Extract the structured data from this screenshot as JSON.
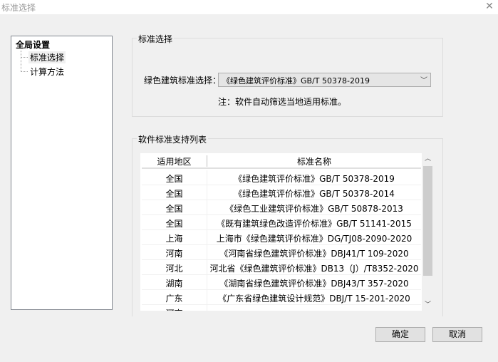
{
  "window": {
    "title": "标准选择",
    "close_icon": "close-icon"
  },
  "tree": {
    "root": "全局设置",
    "items": [
      {
        "label": "标准选择"
      },
      {
        "label": "计算方法"
      }
    ]
  },
  "standard_group": {
    "legend": "标准选择",
    "label": "绿色建筑标准选择：",
    "selected": "《绿色建筑评价标准》GB/T 50378-2019",
    "note": "注：软件自动筛选当地适用标准。"
  },
  "list_group": {
    "legend": "软件标准支持列表",
    "headers": [
      "适用地区",
      "标准名称"
    ],
    "rows": [
      [
        "全国",
        "《绿色建筑评价标准》GB/T 50378-2019"
      ],
      [
        "全国",
        "《绿色建筑评价标准》GB/T 50378-2014"
      ],
      [
        "全国",
        "《绿色工业建筑评价标准》GB/T 50878-2013"
      ],
      [
        "全国",
        "《既有建筑绿色改造评价标准》GB/T 51141-2015"
      ],
      [
        "上海",
        "上海市《绿色建筑评价标准》DG/TJ08-2090-2020"
      ],
      [
        "河南",
        "《河南省绿色建筑评价标准》DBJ41/T 109-2020"
      ],
      [
        "河北",
        "河北省《绿色建筑评价标准》DB13（J）/T8352-2020"
      ],
      [
        "湖南",
        "《湖南省绿色建筑评价标准》DBJ43/T 357-2020"
      ],
      [
        "广东",
        "《广东省绿色建筑设计规范》DBJ/T 15-201-2020"
      ],
      [
        "河南",
        ""
      ]
    ]
  },
  "buttons": {
    "ok": "确定",
    "cancel": "取消"
  }
}
